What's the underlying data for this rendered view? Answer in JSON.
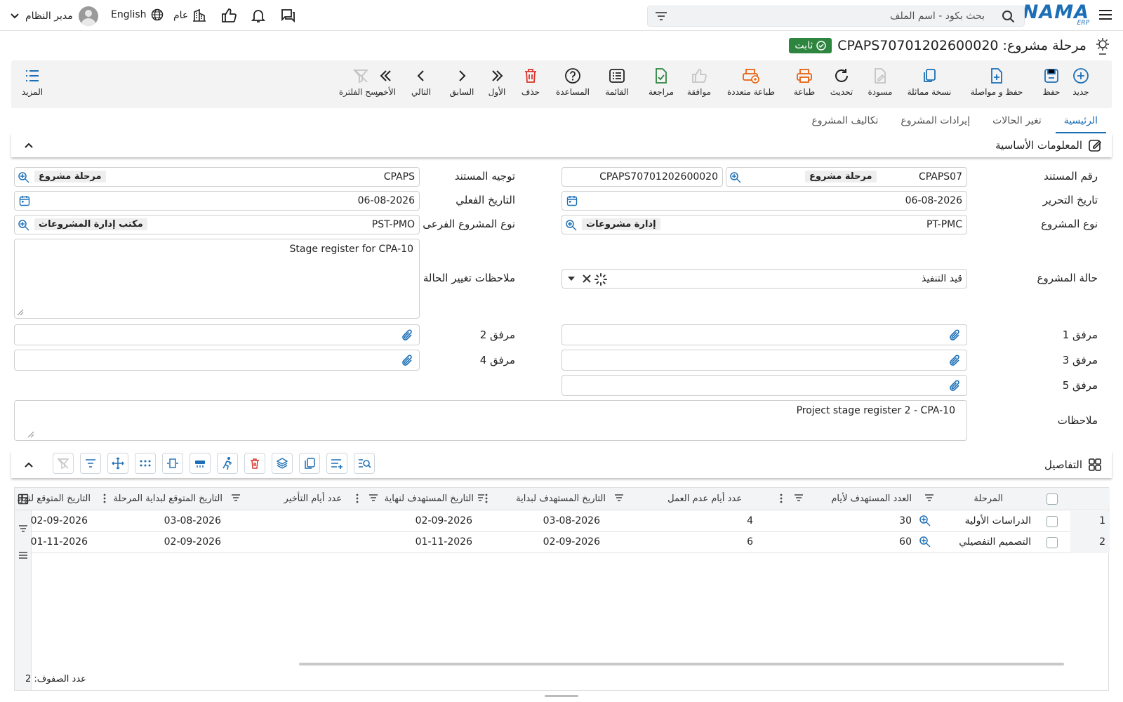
{
  "header": {
    "search_placeholder": "بحث بكود - اسم الملف",
    "logo": "NAMA",
    "logo_sub": "ERP",
    "language": "English",
    "branch": "عام",
    "user": "مدير النظام"
  },
  "title": {
    "text": "مرحلة مشروع: CPAPS70701202600020",
    "status": "ثابت"
  },
  "toolbar": {
    "new": "جديد",
    "save": "حفظ",
    "save_continue": "حفظ و مواصلة",
    "duplicate": "نسخة مماثلة",
    "draft": "مسودة",
    "refresh": "تحديث",
    "print": "طباعة",
    "multi_print": "طباعة متعددة",
    "approve": "موافقة",
    "review": "مراجعة",
    "list": "القائمة",
    "help": "المساعدة",
    "delete": "حذف",
    "first": "الأول",
    "previous": "السابق",
    "next": "التالي",
    "last": "الأخير",
    "clear_filter": "مسح الفلترة",
    "more": "المزيد"
  },
  "tabs": [
    "الرئيسية",
    "تغير الحالات",
    "إيرادات المشروع",
    "تكاليف المشروع"
  ],
  "basic": {
    "section_title": "المعلومات الأساسية",
    "doc_no_label": "رقم المستند",
    "doc_no_prefix": "CPAPS07",
    "doc_no_chip": "مرحلة مشروع",
    "doc_no_value": "CPAPS70701202600020",
    "direction_label": "توجيه المستند",
    "direction_value": "CPAPS",
    "direction_chip": "مرحلة مشروع",
    "edit_date_label": "تاريخ التحرير",
    "edit_date": "06-08-2026",
    "actual_date_label": "التاريخ الفعلي",
    "actual_date": "06-08-2026",
    "type_label": "نوع المشروع",
    "type_value": "PT-PMC",
    "type_chip": "إدارة مشروعات",
    "subtype_label": "نوع المشروع الفرعى",
    "subtype_value": "PST-PMO",
    "subtype_chip": "مكتب إدارة المشروعات",
    "status_label": "حالة المشروع",
    "status_value": "قيد التنفيذ",
    "status_notes_label": "ملاحظات تغيير الحالة",
    "status_notes": "Stage register for CPA-10",
    "att1": "مرفق 1",
    "att2": "مرفق 2",
    "att3": "مرفق 3",
    "att4": "مرفق 4",
    "att5": "مرفق 5",
    "notes_label": "ملاحظات",
    "notes": "Project stage register 2 - CPA-10"
  },
  "details": {
    "section_title": "التفاصيل",
    "columns": [
      "المرحلة",
      "العدد المستهدف لأيام",
      "عدد أيام عدم العمل",
      "التاريخ المستهدف لبداية",
      "التاريخ المستهدف لنهاية",
      "عدد أيام التأخير",
      "التاريخ المتوقع لبداية المرحلة",
      "التاريخ المتوقع لنهاية"
    ],
    "rows": [
      {
        "num": "1",
        "stage": "الدراسات الأولية",
        "target_days": "30",
        "off_days": "4",
        "target_start": "03-08-2026",
        "target_end": "02-09-2026",
        "delay": "",
        "exp_start": "03-08-2026",
        "exp_end": "02-09-2026"
      },
      {
        "num": "2",
        "stage": "التصميم التفصيلي",
        "target_days": "60",
        "off_days": "6",
        "target_start": "02-09-2026",
        "target_end": "01-11-2026",
        "delay": "",
        "exp_start": "02-09-2026",
        "exp_end": "01-11-2026"
      }
    ],
    "row_count": "عدد الصفوف: 2"
  }
}
